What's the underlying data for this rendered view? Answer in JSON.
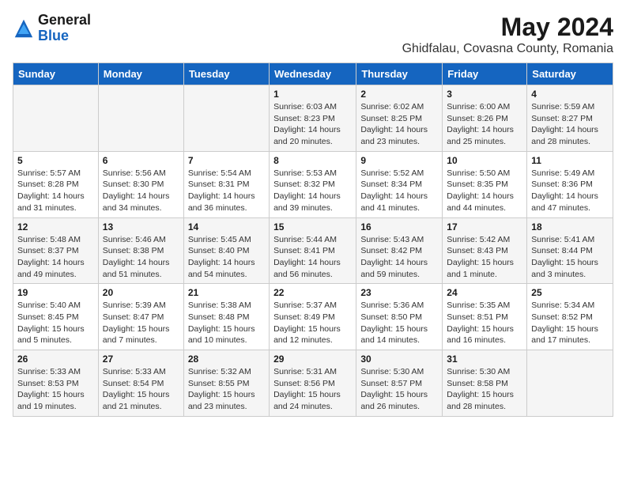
{
  "logo": {
    "general": "General",
    "blue": "Blue"
  },
  "title": {
    "month_year": "May 2024",
    "location": "Ghidfalau, Covasna County, Romania"
  },
  "days_of_week": [
    "Sunday",
    "Monday",
    "Tuesday",
    "Wednesday",
    "Thursday",
    "Friday",
    "Saturday"
  ],
  "weeks": [
    [
      {
        "day": "",
        "info": ""
      },
      {
        "day": "",
        "info": ""
      },
      {
        "day": "",
        "info": ""
      },
      {
        "day": "1",
        "info": "Sunrise: 6:03 AM\nSunset: 8:23 PM\nDaylight: 14 hours\nand 20 minutes."
      },
      {
        "day": "2",
        "info": "Sunrise: 6:02 AM\nSunset: 8:25 PM\nDaylight: 14 hours\nand 23 minutes."
      },
      {
        "day": "3",
        "info": "Sunrise: 6:00 AM\nSunset: 8:26 PM\nDaylight: 14 hours\nand 25 minutes."
      },
      {
        "day": "4",
        "info": "Sunrise: 5:59 AM\nSunset: 8:27 PM\nDaylight: 14 hours\nand 28 minutes."
      }
    ],
    [
      {
        "day": "5",
        "info": "Sunrise: 5:57 AM\nSunset: 8:28 PM\nDaylight: 14 hours\nand 31 minutes."
      },
      {
        "day": "6",
        "info": "Sunrise: 5:56 AM\nSunset: 8:30 PM\nDaylight: 14 hours\nand 34 minutes."
      },
      {
        "day": "7",
        "info": "Sunrise: 5:54 AM\nSunset: 8:31 PM\nDaylight: 14 hours\nand 36 minutes."
      },
      {
        "day": "8",
        "info": "Sunrise: 5:53 AM\nSunset: 8:32 PM\nDaylight: 14 hours\nand 39 minutes."
      },
      {
        "day": "9",
        "info": "Sunrise: 5:52 AM\nSunset: 8:34 PM\nDaylight: 14 hours\nand 41 minutes."
      },
      {
        "day": "10",
        "info": "Sunrise: 5:50 AM\nSunset: 8:35 PM\nDaylight: 14 hours\nand 44 minutes."
      },
      {
        "day": "11",
        "info": "Sunrise: 5:49 AM\nSunset: 8:36 PM\nDaylight: 14 hours\nand 47 minutes."
      }
    ],
    [
      {
        "day": "12",
        "info": "Sunrise: 5:48 AM\nSunset: 8:37 PM\nDaylight: 14 hours\nand 49 minutes."
      },
      {
        "day": "13",
        "info": "Sunrise: 5:46 AM\nSunset: 8:38 PM\nDaylight: 14 hours\nand 51 minutes."
      },
      {
        "day": "14",
        "info": "Sunrise: 5:45 AM\nSunset: 8:40 PM\nDaylight: 14 hours\nand 54 minutes."
      },
      {
        "day": "15",
        "info": "Sunrise: 5:44 AM\nSunset: 8:41 PM\nDaylight: 14 hours\nand 56 minutes."
      },
      {
        "day": "16",
        "info": "Sunrise: 5:43 AM\nSunset: 8:42 PM\nDaylight: 14 hours\nand 59 minutes."
      },
      {
        "day": "17",
        "info": "Sunrise: 5:42 AM\nSunset: 8:43 PM\nDaylight: 15 hours\nand 1 minute."
      },
      {
        "day": "18",
        "info": "Sunrise: 5:41 AM\nSunset: 8:44 PM\nDaylight: 15 hours\nand 3 minutes."
      }
    ],
    [
      {
        "day": "19",
        "info": "Sunrise: 5:40 AM\nSunset: 8:45 PM\nDaylight: 15 hours\nand 5 minutes."
      },
      {
        "day": "20",
        "info": "Sunrise: 5:39 AM\nSunset: 8:47 PM\nDaylight: 15 hours\nand 7 minutes."
      },
      {
        "day": "21",
        "info": "Sunrise: 5:38 AM\nSunset: 8:48 PM\nDaylight: 15 hours\nand 10 minutes."
      },
      {
        "day": "22",
        "info": "Sunrise: 5:37 AM\nSunset: 8:49 PM\nDaylight: 15 hours\nand 12 minutes."
      },
      {
        "day": "23",
        "info": "Sunrise: 5:36 AM\nSunset: 8:50 PM\nDaylight: 15 hours\nand 14 minutes."
      },
      {
        "day": "24",
        "info": "Sunrise: 5:35 AM\nSunset: 8:51 PM\nDaylight: 15 hours\nand 16 minutes."
      },
      {
        "day": "25",
        "info": "Sunrise: 5:34 AM\nSunset: 8:52 PM\nDaylight: 15 hours\nand 17 minutes."
      }
    ],
    [
      {
        "day": "26",
        "info": "Sunrise: 5:33 AM\nSunset: 8:53 PM\nDaylight: 15 hours\nand 19 minutes."
      },
      {
        "day": "27",
        "info": "Sunrise: 5:33 AM\nSunset: 8:54 PM\nDaylight: 15 hours\nand 21 minutes."
      },
      {
        "day": "28",
        "info": "Sunrise: 5:32 AM\nSunset: 8:55 PM\nDaylight: 15 hours\nand 23 minutes."
      },
      {
        "day": "29",
        "info": "Sunrise: 5:31 AM\nSunset: 8:56 PM\nDaylight: 15 hours\nand 24 minutes."
      },
      {
        "day": "30",
        "info": "Sunrise: 5:30 AM\nSunset: 8:57 PM\nDaylight: 15 hours\nand 26 minutes."
      },
      {
        "day": "31",
        "info": "Sunrise: 5:30 AM\nSunset: 8:58 PM\nDaylight: 15 hours\nand 28 minutes."
      },
      {
        "day": "",
        "info": ""
      }
    ]
  ]
}
